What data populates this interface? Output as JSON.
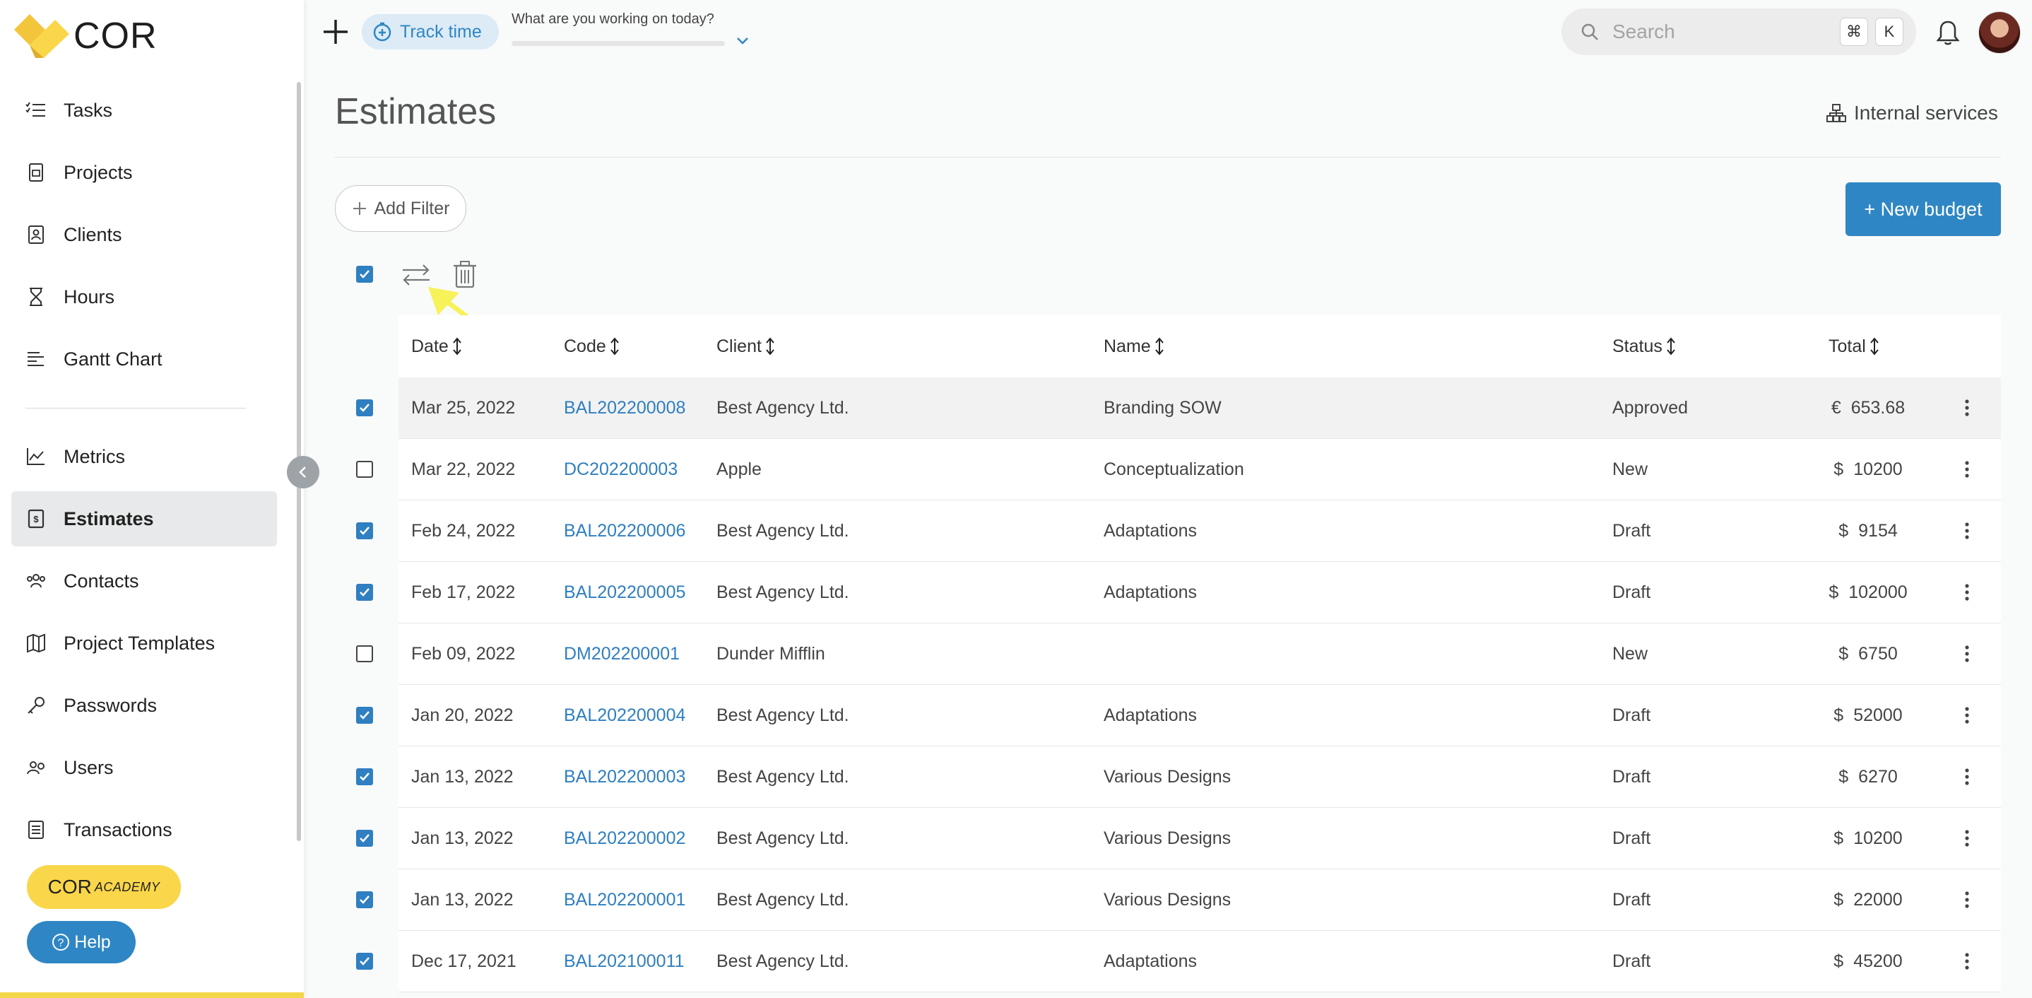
{
  "brand": {
    "name": "COR",
    "accent": "#fad64a",
    "primary": "#2f86c4"
  },
  "sidebar": {
    "items": [
      {
        "label": "Tasks",
        "icon": "tasks-icon",
        "active": false
      },
      {
        "label": "Projects",
        "icon": "projects-icon",
        "active": false
      },
      {
        "label": "Clients",
        "icon": "clients-icon",
        "active": false
      },
      {
        "label": "Hours",
        "icon": "hourglass-icon",
        "active": false
      },
      {
        "label": "Gantt Chart",
        "icon": "gantt-icon",
        "active": false
      },
      {
        "label": "Metrics",
        "icon": "metrics-icon",
        "active": false
      },
      {
        "label": "Estimates",
        "icon": "estimates-icon",
        "active": true
      },
      {
        "label": "Contacts",
        "icon": "contacts-icon",
        "active": false
      },
      {
        "label": "Project Templates",
        "icon": "templates-icon",
        "active": false
      },
      {
        "label": "Passwords",
        "icon": "key-icon",
        "active": false
      },
      {
        "label": "Users",
        "icon": "users-icon",
        "active": false
      },
      {
        "label": "Transactions",
        "icon": "transactions-icon",
        "active": false
      }
    ],
    "academy_main": "COR",
    "academy_sub": "ACADEMY",
    "help_label": "Help"
  },
  "topbar": {
    "track_time_label": "Track time",
    "work_prompt": "What are you working on today?",
    "search_placeholder": "Search",
    "shortcut_mod": "⌘",
    "shortcut_key": "K"
  },
  "page": {
    "title": "Estimates",
    "internal_services_label": "Internal services",
    "add_filter_label": "Add Filter",
    "new_budget_label": "+ New budget"
  },
  "table": {
    "columns": {
      "date": "Date",
      "code": "Code",
      "client": "Client",
      "name": "Name",
      "status": "Status",
      "total": "Total"
    },
    "rows": [
      {
        "checked": true,
        "date": "Mar 25, 2022",
        "code": "BAL202200008",
        "client": "Best Agency Ltd.",
        "name": "Branding SOW",
        "status": "Approved",
        "currency": "€",
        "total": "653.68",
        "highlight": true
      },
      {
        "checked": false,
        "date": "Mar 22, 2022",
        "code": "DC202200003",
        "client": "Apple",
        "name": "Conceptualization",
        "status": "New",
        "currency": "$",
        "total": "10200"
      },
      {
        "checked": true,
        "date": "Feb 24, 2022",
        "code": "BAL202200006",
        "client": "Best Agency Ltd.",
        "name": "Adaptations",
        "status": "Draft",
        "currency": "$",
        "total": "9154"
      },
      {
        "checked": true,
        "date": "Feb 17, 2022",
        "code": "BAL202200005",
        "client": "Best Agency Ltd.",
        "name": "Adaptations",
        "status": "Draft",
        "currency": "$",
        "total": "102000"
      },
      {
        "checked": false,
        "date": "Feb 09, 2022",
        "code": "DM202200001",
        "client": "Dunder Mifflin",
        "name": "",
        "status": "New",
        "currency": "$",
        "total": "6750"
      },
      {
        "checked": true,
        "date": "Jan 20, 2022",
        "code": "BAL202200004",
        "client": "Best Agency Ltd.",
        "name": "Adaptations",
        "status": "Draft",
        "currency": "$",
        "total": "52000"
      },
      {
        "checked": true,
        "date": "Jan 13, 2022",
        "code": "BAL202200003",
        "client": "Best Agency Ltd.",
        "name": "Various Designs",
        "status": "Draft",
        "currency": "$",
        "total": "6270"
      },
      {
        "checked": true,
        "date": "Jan 13, 2022",
        "code": "BAL202200002",
        "client": "Best Agency Ltd.",
        "name": "Various Designs",
        "status": "Draft",
        "currency": "$",
        "total": "10200"
      },
      {
        "checked": true,
        "date": "Jan 13, 2022",
        "code": "BAL202200001",
        "client": "Best Agency Ltd.",
        "name": "Various Designs",
        "status": "Draft",
        "currency": "$",
        "total": "22000"
      },
      {
        "checked": true,
        "date": "Dec 17, 2021",
        "code": "BAL202100011",
        "client": "Best Agency Ltd.",
        "name": "Adaptations",
        "status": "Draft",
        "currency": "$",
        "total": "45200"
      }
    ]
  },
  "annotation": {
    "icon": "arrow-icon",
    "color": "#f7f25a"
  }
}
